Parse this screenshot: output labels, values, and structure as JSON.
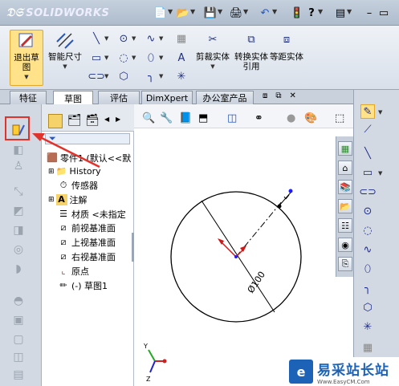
{
  "app": {
    "name": "SOLIDWORKS"
  },
  "command_manager": {
    "exit_sketch": "退出草图",
    "smart_dimension": "智能尺寸",
    "trim": "剪裁实体",
    "convert": "转换实体引用",
    "offset": "等距实体"
  },
  "tabs": [
    {
      "label": "特征"
    },
    {
      "label": "草图"
    },
    {
      "label": "评估"
    },
    {
      "label": "DimXpert"
    },
    {
      "label": "办公室产品"
    }
  ],
  "tree": {
    "part": "零件1 (默认<<默",
    "history": "History",
    "sensors": "传感器",
    "annotations": "注解",
    "material": "材质 <未指定",
    "front_plane": "前视基准面",
    "top_plane": "上视基准面",
    "right_plane": "右视基准面",
    "origin": "原点",
    "sketch": "(-) 草图1"
  },
  "sketch": {
    "dimension": "Ø100"
  },
  "triad": {
    "x": "X",
    "y": "Y",
    "z": "Z"
  },
  "watermark": {
    "cn": "易采站长站",
    "en": "Www.EasyCM.Com"
  },
  "colors": {
    "accent_red": "#e0332c",
    "sketch_blue": "#1c1cff"
  }
}
